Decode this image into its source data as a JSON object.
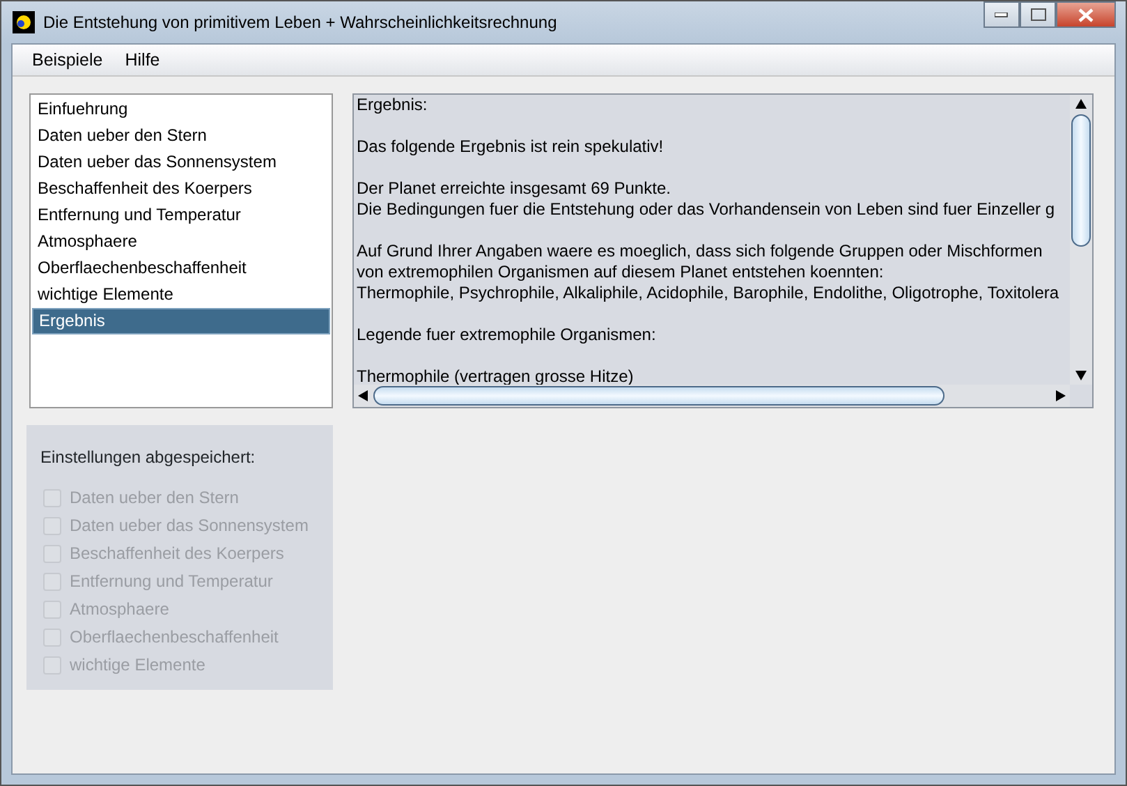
{
  "window": {
    "title": "Die Entstehung von primitivem Leben + Wahrscheinlichkeitsrechnung"
  },
  "menu": [
    "Beispiele",
    "Hilfe"
  ],
  "sections": [
    {
      "label": "Einfuehrung",
      "selected": false
    },
    {
      "label": "Daten ueber den Stern",
      "selected": false
    },
    {
      "label": "Daten ueber das Sonnensystem",
      "selected": false
    },
    {
      "label": "Beschaffenheit des Koerpers",
      "selected": false
    },
    {
      "label": "Entfernung und Temperatur",
      "selected": false
    },
    {
      "label": "Atmosphaere",
      "selected": false
    },
    {
      "label": "Oberflaechenbeschaffenheit",
      "selected": false
    },
    {
      "label": "wichtige Elemente",
      "selected": false
    },
    {
      "label": "Ergebnis",
      "selected": true
    }
  ],
  "result_paragraphs": [
    [
      "Ergebnis:"
    ],
    [
      "Das folgende Ergebnis ist rein spekulativ!"
    ],
    [
      "Der Planet erreichte insgesamt 69 Punkte.",
      "Die Bedingungen fuer die Entstehung oder das Vorhandensein von Leben sind fuer Einzeller g"
    ],
    [
      "Auf Grund Ihrer Angaben waere es moeglich, dass sich folgende Gruppen oder Mischformen",
      "von extremophilen Organismen auf diesem Planet entstehen koennten:",
      "Thermophile, Psychrophile, Alkaliphile, Acidophile, Barophile, Endolithe, Oligotrophe, Toxitolera"
    ],
    [
      "Legende fuer extremophile Organismen:"
    ],
    [
      "Thermophile (vertragen grosse Hitze)"
    ]
  ],
  "settings": {
    "title": "Einstellungen abgespeichert:",
    "items": [
      {
        "label": "Daten ueber den Stern",
        "checked": false,
        "disabled": true
      },
      {
        "label": "Daten ueber das Sonnensystem",
        "checked": false,
        "disabled": true
      },
      {
        "label": "Beschaffenheit des Koerpers",
        "checked": false,
        "disabled": true
      },
      {
        "label": "Entfernung und Temperatur",
        "checked": false,
        "disabled": true
      },
      {
        "label": "Atmosphaere",
        "checked": false,
        "disabled": true
      },
      {
        "label": "Oberflaechenbeschaffenheit",
        "checked": false,
        "disabled": true
      },
      {
        "label": "wichtige Elemente",
        "checked": false,
        "disabled": true
      }
    ]
  }
}
